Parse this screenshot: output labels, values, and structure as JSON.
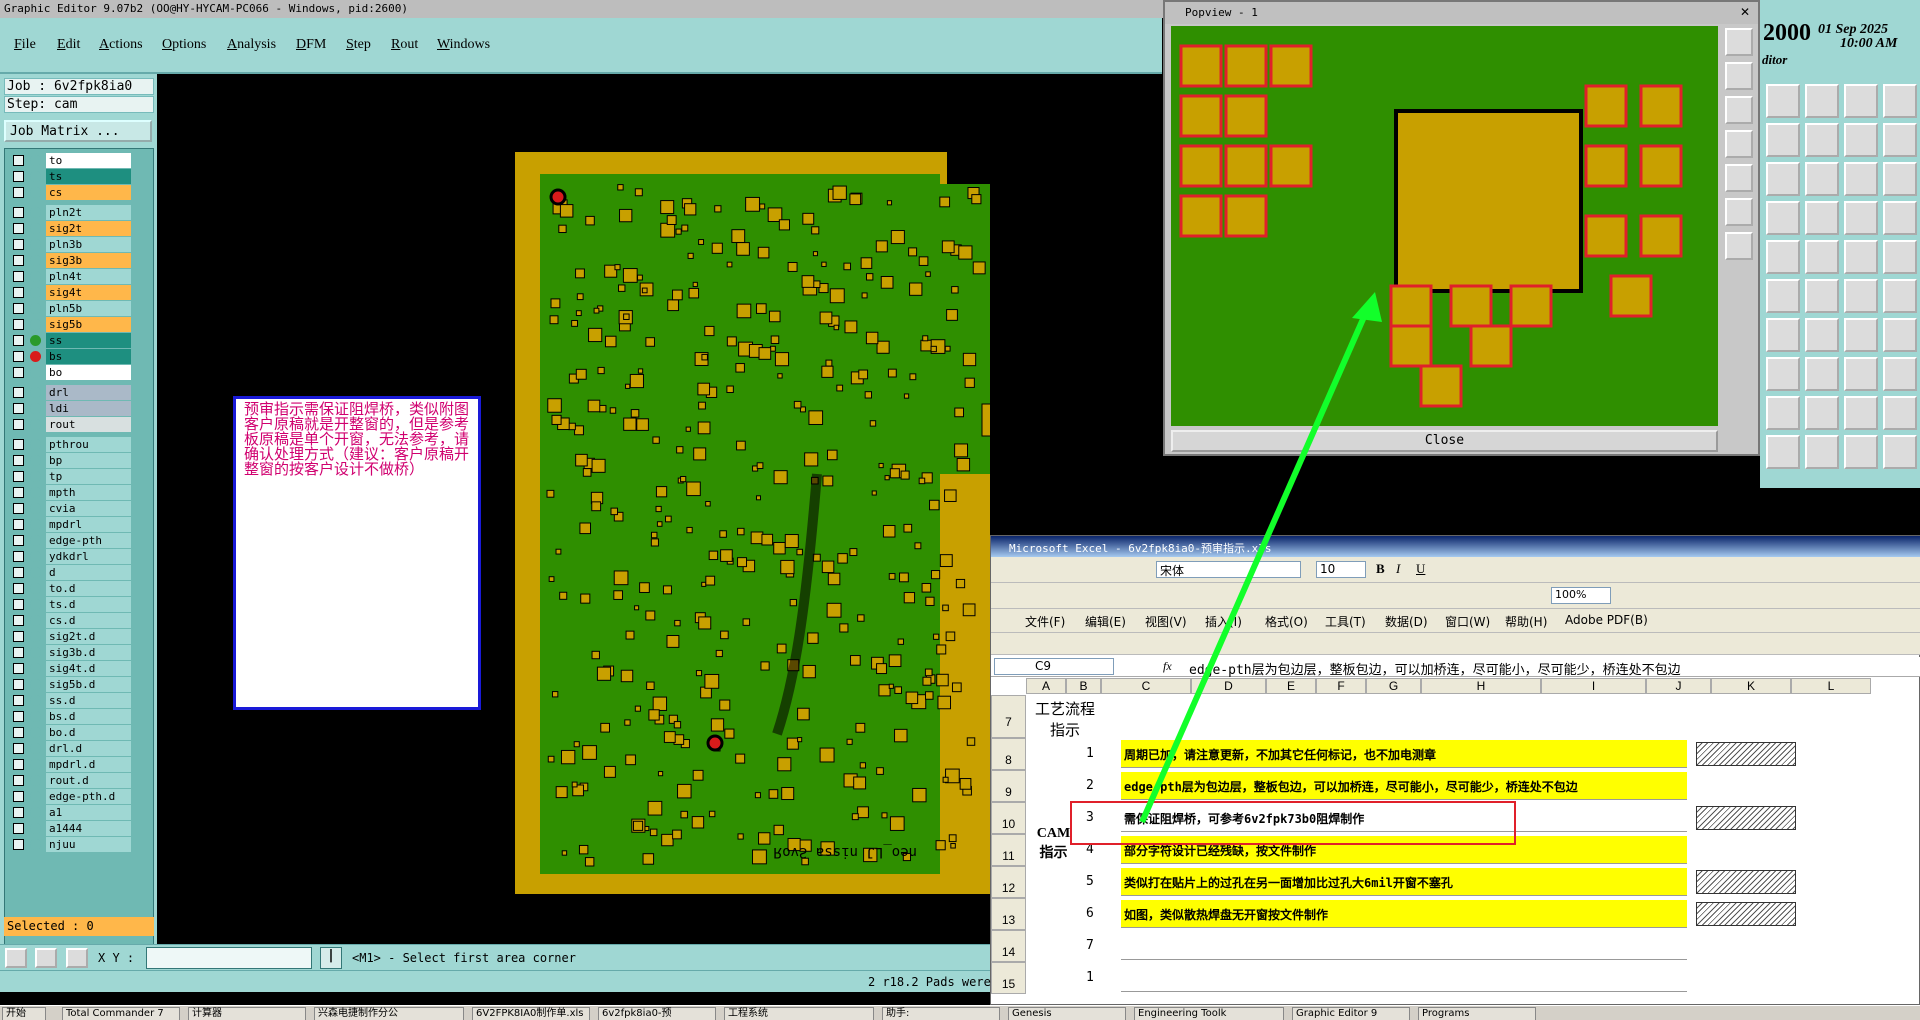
{
  "window_title": "Graphic Editor 9.07b2 (OO@HY-HYCAM-PC066 - Windows, pid:2600)",
  "menu": [
    "File",
    "Edit",
    "Actions",
    "Options",
    "Analysis",
    "DFM",
    "Step",
    "Rout",
    "Windows"
  ],
  "job": {
    "job_label": "Job : 6v2fpk8ia0",
    "step_label": "Step: cam",
    "matrix_button": "Job Matrix ..."
  },
  "layers": [
    {
      "name": "to",
      "color": "#ffffff",
      "dot": "#6fb9b3"
    },
    {
      "name": "ts",
      "color": "#1e8f80",
      "dot": "#6fb9b3"
    },
    {
      "name": "cs",
      "color": "#ffb74a",
      "dot": "#6fb9b3"
    },
    {
      "name": "pln2t",
      "color": "#9fd7d3",
      "dot": "#6fb9b3"
    },
    {
      "name": "sig2t",
      "color": "#ffb74a",
      "dot": "#6fb9b3"
    },
    {
      "name": "pln3b",
      "color": "#9fd7d3",
      "dot": "#6fb9b3"
    },
    {
      "name": "sig3b",
      "color": "#ffb74a",
      "dot": "#6fb9b3"
    },
    {
      "name": "pln4t",
      "color": "#9fd7d3",
      "dot": "#6fb9b3"
    },
    {
      "name": "sig4t",
      "color": "#ffb74a",
      "dot": "#6fb9b3"
    },
    {
      "name": "pln5b",
      "color": "#9fd7d3",
      "dot": "#6fb9b3"
    },
    {
      "name": "sig5b",
      "color": "#ffb74a",
      "dot": "#6fb9b3"
    },
    {
      "name": "ss",
      "color": "#1e8f80",
      "dot": "#2a9a2a"
    },
    {
      "name": "bs",
      "color": "#1e8f80",
      "dot": "#d81b1b"
    },
    {
      "name": "bo",
      "color": "#ffffff",
      "dot": "#6fb9b3"
    },
    {
      "name": "drl",
      "color": "#aab9c8",
      "dot": "#6fb9b3"
    },
    {
      "name": "ldi",
      "color": "#aab9c8",
      "dot": "#6fb9b3"
    },
    {
      "name": "rout",
      "color": "#d8e0e0",
      "dot": "#6fb9b3"
    },
    {
      "name": "pthrou",
      "color": "#9fd7d3",
      "dot": "#6fb9b3"
    },
    {
      "name": "bp",
      "color": "#9fd7d3",
      "dot": "#6fb9b3"
    },
    {
      "name": "tp",
      "color": "#9fd7d3",
      "dot": "#6fb9b3"
    },
    {
      "name": "mpth",
      "color": "#9fd7d3",
      "dot": "#6fb9b3"
    },
    {
      "name": "cvia",
      "color": "#9fd7d3",
      "dot": "#6fb9b3"
    },
    {
      "name": "mpdrl",
      "color": "#9fd7d3",
      "dot": "#6fb9b3"
    },
    {
      "name": "edge-pth",
      "color": "#9fd7d3",
      "dot": "#6fb9b3"
    },
    {
      "name": "ydkdrl",
      "color": "#9fd7d3",
      "dot": "#6fb9b3"
    },
    {
      "name": "d",
      "color": "#9fd7d3",
      "dot": "#6fb9b3"
    },
    {
      "name": "to.d",
      "color": "#9fd7d3",
      "dot": "#6fb9b3"
    },
    {
      "name": "ts.d",
      "color": "#9fd7d3",
      "dot": "#6fb9b3"
    },
    {
      "name": "cs.d",
      "color": "#9fd7d3",
      "dot": "#6fb9b3"
    },
    {
      "name": "sig2t.d",
      "color": "#9fd7d3",
      "dot": "#6fb9b3"
    },
    {
      "name": "sig3b.d",
      "color": "#9fd7d3",
      "dot": "#6fb9b3"
    },
    {
      "name": "sig4t.d",
      "color": "#9fd7d3",
      "dot": "#6fb9b3"
    },
    {
      "name": "sig5b.d",
      "color": "#9fd7d3",
      "dot": "#6fb9b3"
    },
    {
      "name": "ss.d",
      "color": "#9fd7d3",
      "dot": "#6fb9b3"
    },
    {
      "name": "bs.d",
      "color": "#9fd7d3",
      "dot": "#6fb9b3"
    },
    {
      "name": "bo.d",
      "color": "#9fd7d3",
      "dot": "#6fb9b3"
    },
    {
      "name": "drl.d",
      "color": "#9fd7d3",
      "dot": "#6fb9b3"
    },
    {
      "name": "mpdrl.d",
      "color": "#9fd7d3",
      "dot": "#6fb9b3"
    },
    {
      "name": "rout.d",
      "color": "#9fd7d3",
      "dot": "#6fb9b3"
    },
    {
      "name": "edge-pth.d",
      "color": "#9fd7d3",
      "dot": "#6fb9b3"
    },
    {
      "name": "a1",
      "color": "#9fd7d3",
      "dot": "#6fb9b3"
    },
    {
      "name": "a1444",
      "color": "#9fd7d3",
      "dot": "#6fb9b3"
    },
    {
      "name": "njuu",
      "color": "#9fd7d3",
      "dot": "#6fb9b3"
    }
  ],
  "selected_label": "Selected : 0",
  "status": {
    "xy_label": "X Y :",
    "xy_value": "",
    "prompt": "<M1> - Select first area corner",
    "pads_info": "2 r18.2 Pads were"
  },
  "note_text": "预审指示需保证阻焊桥，类似附图客户原稿就是开整窗的，但是参考板原稿是单个开窗，无法参考，请确认处理方式（建议：客户原稿开整窗的按客户设计不做桥）",
  "board_silk_text": "neo_LJ nissa ƧvoЯ",
  "popview": {
    "title": "Popview - 1",
    "close_label": "Close"
  },
  "clock": {
    "year": "2000",
    "date": "01 Sep 2025",
    "time": "10:00 AM",
    "app": "ditor"
  },
  "excel": {
    "title": "Microsoft Excel - 6v2fpk8ia0-预审指示.xls",
    "font_name": "宋体",
    "font_size": "10",
    "zoom": "100%",
    "menu": [
      "文件(F)",
      "编辑(E)",
      "视图(V)",
      "插入(I)",
      "格式(O)",
      "工具(T)",
      "数据(D)",
      "窗口(W)",
      "帮助(H)",
      "Adobe PDF(B)"
    ],
    "name_box": "C9",
    "formula": "edge-pth层为包边层，整板包边，可以加桥连，尽可能小，尽可能少，桥连处不包边",
    "columns": [
      "A",
      "B",
      "C",
      "D",
      "E",
      "F",
      "G",
      "H",
      "I",
      "J",
      "K",
      "L"
    ],
    "row_numbers": [
      "7",
      "8",
      "9",
      "10",
      "11",
      "12",
      "13",
      "14",
      "15"
    ],
    "header_cell": "工艺流程指示",
    "group_label": "CAM指示",
    "rows": [
      {
        "num": "1",
        "text": "周期已加，请注意更新，不加其它任何标记，也不加电测章",
        "yellow": true
      },
      {
        "num": "2",
        "text": "edge-pth层为包边层，整板包边，可以加桥连，尽可能小，尽可能少，桥连处不包边",
        "yellow": true
      },
      {
        "num": "3",
        "text": "需保证阻焊桥，可参考6v2fpk73b0阻焊制作",
        "yellow": false
      },
      {
        "num": "4",
        "text": "部分字符设计已经残缺，按文件制作",
        "yellow": true
      },
      {
        "num": "5",
        "text": "类似打在贴片上的过孔在另一面增加比过孔大6mil开窗不塞孔",
        "yellow": true
      },
      {
        "num": "6",
        "text": "如图，类似散热焊盘无开窗按文件制作",
        "yellow": true
      },
      {
        "num": "7",
        "text": "",
        "yellow": false
      },
      {
        "num": "1",
        "text": "",
        "yellow": false
      }
    ]
  },
  "taskbar": [
    "开始",
    "Total Commander 7",
    "计算器",
    "兴森电捷制作分公",
    "6V2FPK8IA0制作单.xls",
    "6v2fpk8ia0-预",
    "工程系统",
    "助手:",
    "Genesis",
    "Engineering Toolk",
    "Graphic Editor 9",
    "Programs"
  ],
  "colors": {
    "board_green": "#2f8f00",
    "board_gold": "#c8a000",
    "panel_teal": "#9fd7d3",
    "arrow_green": "#12ff2a",
    "highlight_red": "#e0202a"
  }
}
